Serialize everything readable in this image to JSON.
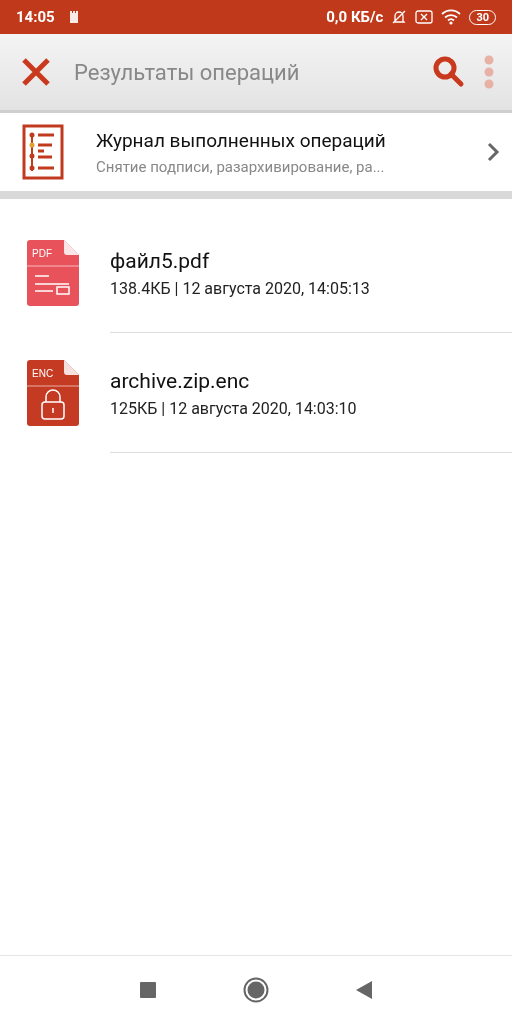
{
  "status_bar": {
    "time": "14:05",
    "speed": "0,0 КБ/с",
    "battery": "30"
  },
  "toolbar": {
    "title": "Результаты операций"
  },
  "journal": {
    "title": "Журнал выполненных операций",
    "subtitle": "Снятие подписи, разархивирование, ра..."
  },
  "files": [
    {
      "kind": "pdf",
      "badge": "PDF",
      "name": "файл5.pdf",
      "meta": "138.4КБ | 12 августа 2020, 14:05:13"
    },
    {
      "kind": "enc",
      "badge": "ENC",
      "name": "archive.zip.enc",
      "meta": "125КБ | 12 августа 2020, 14:03:10"
    }
  ]
}
